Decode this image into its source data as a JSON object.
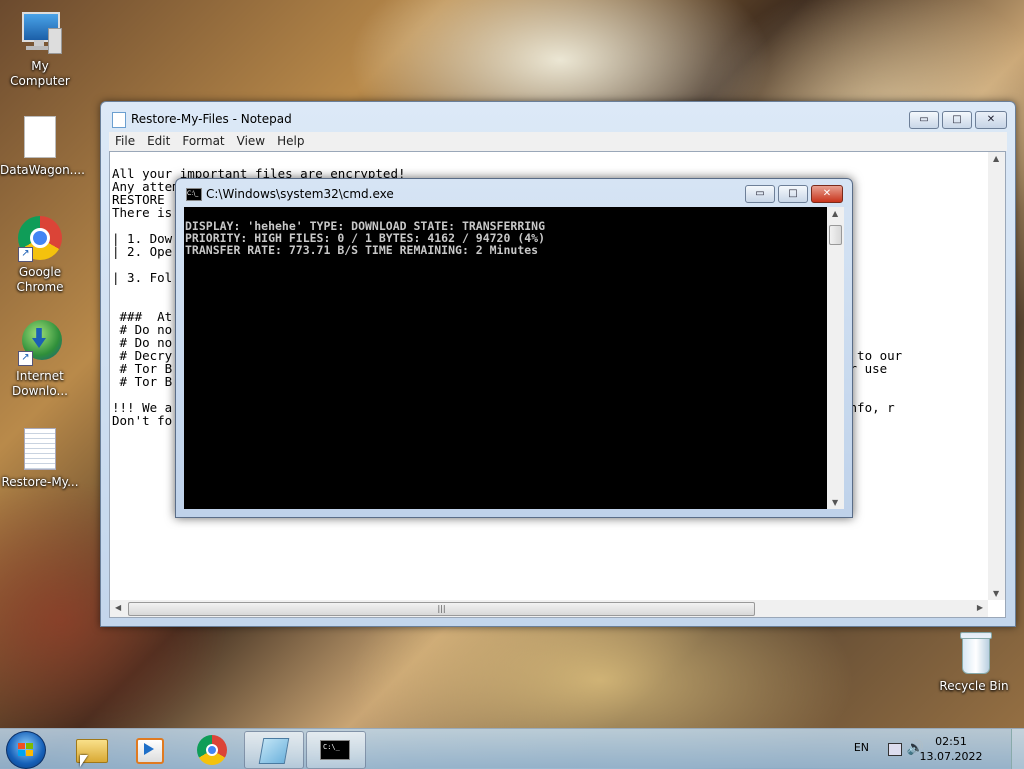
{
  "desktop": {
    "icons": [
      {
        "label": "My Computer"
      },
      {
        "label": "DataWagon...."
      },
      {
        "label": "Google Chrome"
      },
      {
        "label": "Internet Downlo..."
      },
      {
        "label": "Restore-My..."
      },
      {
        "label": "Recycle Bin"
      }
    ]
  },
  "notepad": {
    "title": "Restore-My-Files - Notepad",
    "menu": [
      "File",
      "Edit",
      "Format",
      "View",
      "Help"
    ],
    "lines": [
      "All your important files are encrypted!",
      "Any attempts to restore your files with the thrid-party software will be fatal for your files!",
      "RESTORE",
      "There is",
      "",
      "| 1. Dow",
      "| 2. Ope                                                                                A5",
      "",
      "| 3. Fol",
      "",
      "",
      " ###  At",
      " # Do no",
      " # Do no",
      " # Decry                                                                               d their fee to our",
      " # Tor B                                                                              roject.org or use",
      " # Tor B",
      "",
      "!!! We a                                                                              s personal info, r",
      "Don't fo"
    ]
  },
  "cmd": {
    "title": "C:\\Windows\\system32\\cmd.exe",
    "lines": [
      "DISPLAY: 'hehehe' TYPE: DOWNLOAD STATE: TRANSFERRING",
      "PRIORITY: HIGH FILES: 0 / 1 BYTES: 4162 / 94720 (4%)",
      "TRANSFER RATE: 773.71 B/S TIME REMAINING: 2 Minutes"
    ]
  },
  "window_controls": {
    "minimize": "▭",
    "maximize": "□",
    "close": "✕"
  },
  "taskbar": {
    "language": "EN",
    "time": "02:51",
    "date": "13.07.2022"
  }
}
